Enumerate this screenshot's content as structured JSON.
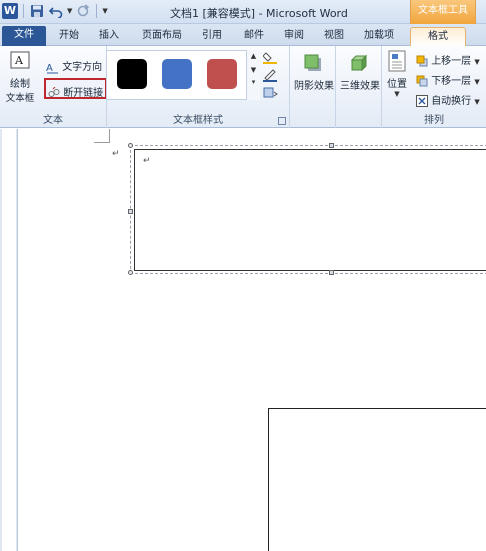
{
  "title_bar": {
    "document_title": "文档1 [兼容模式] - Microsoft Word",
    "contextual_group": "文本框工具"
  },
  "tabs": [
    {
      "label": "文件"
    },
    {
      "label": "开始"
    },
    {
      "label": "插入"
    },
    {
      "label": "页面布局"
    },
    {
      "label": "引用"
    },
    {
      "label": "邮件"
    },
    {
      "label": "审阅"
    },
    {
      "label": "视图"
    },
    {
      "label": "加载项"
    },
    {
      "label": "格式"
    }
  ],
  "ribbon": {
    "text_group": {
      "label": "文本",
      "draw_textbox_line1": "绘制",
      "draw_textbox_line2": "文本框",
      "text_direction": "文字方向",
      "break_link": "断开链接"
    },
    "textbox_styles_group": {
      "label": "文本框样式",
      "swatches": [
        "#000000",
        "#4472c4",
        "#c0504d"
      ]
    },
    "shadow_effects": {
      "label": "阴影效果"
    },
    "threed_effects": {
      "label": "三维效果"
    },
    "arrange_group": {
      "label": "排列",
      "position": "位置",
      "bring_forward": "上移一层",
      "send_backward": "下移一层",
      "wrap_text": "自动换行"
    }
  },
  "document": {
    "paragraph_mark": "↵"
  },
  "colors": {
    "file_tab": "#2b5797",
    "contextual": "#f2a53c",
    "highlight_box": "#c0272d"
  }
}
